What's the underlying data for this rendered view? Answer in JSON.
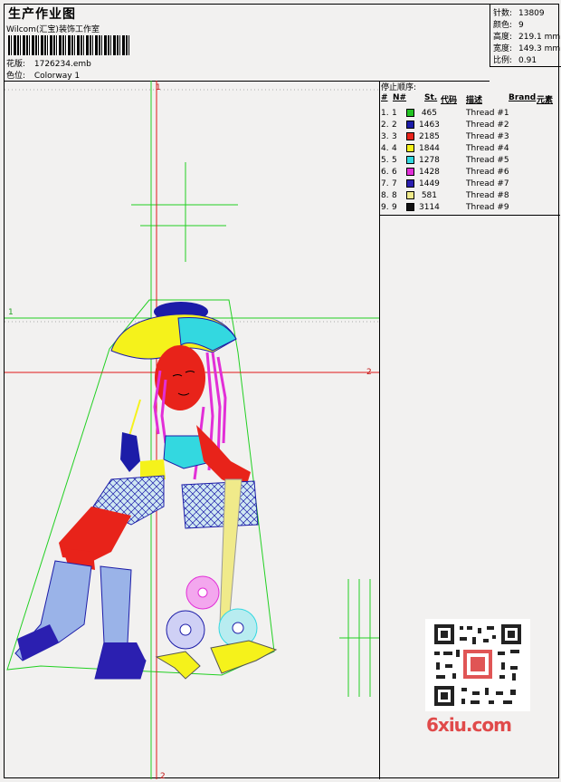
{
  "header": {
    "title": "生产作业图",
    "studio": "Wilcom(汇宝)装饰工作室",
    "design_label": "花版:",
    "design_value": "1726234.emb",
    "colorway_label": "色位:",
    "colorway_value": "Colorway 1"
  },
  "stats": [
    {
      "label": "针数:",
      "value": "13809"
    },
    {
      "label": "颜色:",
      "value": "9"
    },
    {
      "label": "高度:",
      "value": "219.1 mm"
    },
    {
      "label": "宽度:",
      "value": "149.3 mm"
    },
    {
      "label": "比例:",
      "value": "0.91"
    }
  ],
  "sequence": {
    "title": "停止顺序:",
    "headers": {
      "num": "#",
      "n": "N#",
      "st": "St.",
      "code": "代码",
      "desc": "描述",
      "brand": "Brand",
      "element": "元素"
    },
    "rows": [
      {
        "num": "1.",
        "n": "1",
        "color": "#22c322",
        "code": "465",
        "desc": "Thread #1"
      },
      {
        "num": "2.",
        "n": "2",
        "color": "#1c1ca8",
        "code": "1463",
        "desc": "Thread #2"
      },
      {
        "num": "3.",
        "n": "3",
        "color": "#e8231a",
        "code": "2185",
        "desc": "Thread #3"
      },
      {
        "num": "4.",
        "n": "4",
        "color": "#f5f21b",
        "code": "1844",
        "desc": "Thread #4"
      },
      {
        "num": "5.",
        "n": "5",
        "color": "#33d8e0",
        "code": "1278",
        "desc": "Thread #5"
      },
      {
        "num": "6.",
        "n": "6",
        "color": "#e22fd7",
        "code": "1428",
        "desc": "Thread #6"
      },
      {
        "num": "7.",
        "n": "7",
        "color": "#2b1fb0",
        "code": "1449",
        "desc": "Thread #7"
      },
      {
        "num": "8.",
        "n": "8",
        "color": "#f0ea8a",
        "code": "581",
        "desc": "Thread #8"
      },
      {
        "num": "9.",
        "n": "9",
        "color": "#111111",
        "code": "3114",
        "desc": "Thread #9"
      }
    ]
  },
  "canvas": {
    "guide_labels": {
      "h1": "1",
      "h2": "2",
      "v1": "1",
      "v2": "2"
    }
  },
  "watermark": {
    "site": "6xiu.com"
  },
  "icons": {
    "qr": "qr-code-icon"
  }
}
